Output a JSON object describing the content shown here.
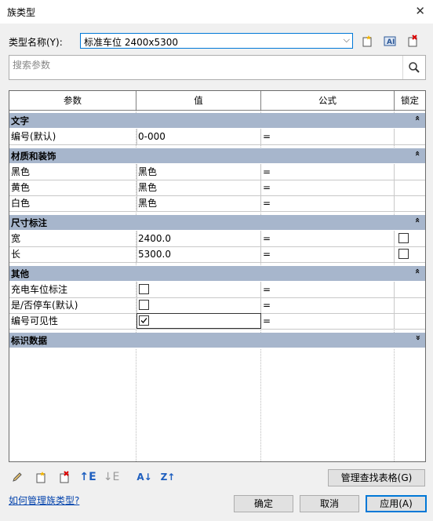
{
  "window": {
    "title": "族类型"
  },
  "type_name": {
    "label": "类型名称(Y):",
    "value": "标准车位  2400x5300"
  },
  "search": {
    "placeholder": "搜索参数"
  },
  "table": {
    "headers": [
      "参数",
      "值",
      "公式",
      "锁定"
    ],
    "groups": [
      {
        "name": "文字",
        "rows": [
          {
            "param": "编号(默认)",
            "value": "0-000",
            "formula": "="
          }
        ]
      },
      {
        "name": "材质和装饰",
        "rows": [
          {
            "param": "黑色",
            "value": "黑色",
            "formula": "="
          },
          {
            "param": "黄色",
            "value": "黑色",
            "formula": "="
          },
          {
            "param": "白色",
            "value": "黑色",
            "formula": "="
          }
        ]
      },
      {
        "name": "尺寸标注",
        "rows": [
          {
            "param": "宽",
            "value": "2400.0",
            "formula": "="
          },
          {
            "param": "长",
            "value": "5300.0",
            "formula": "="
          }
        ]
      },
      {
        "name": "其他",
        "rows": [
          {
            "param": "充电车位标注",
            "checked": false,
            "formula": "="
          },
          {
            "param": "是/否停车(默认)",
            "checked": false,
            "formula": "="
          },
          {
            "param": "编号可见性",
            "checked": true,
            "formula": "="
          }
        ]
      },
      {
        "name": "标识数据",
        "rows": []
      }
    ],
    "collapse_glyph": "«"
  },
  "buttons": {
    "manage_lookup": "管理查找表格(G)",
    "ok": "确定",
    "cancel": "取消",
    "apply": "应用(A)"
  },
  "help_link": "如何管理族类型?",
  "icons": [
    "pencil-icon",
    "new-type-icon",
    "delete-type-icon",
    "move-up-icon",
    "move-down-icon",
    "sort-ascending-icon",
    "sort-descending-icon"
  ]
}
